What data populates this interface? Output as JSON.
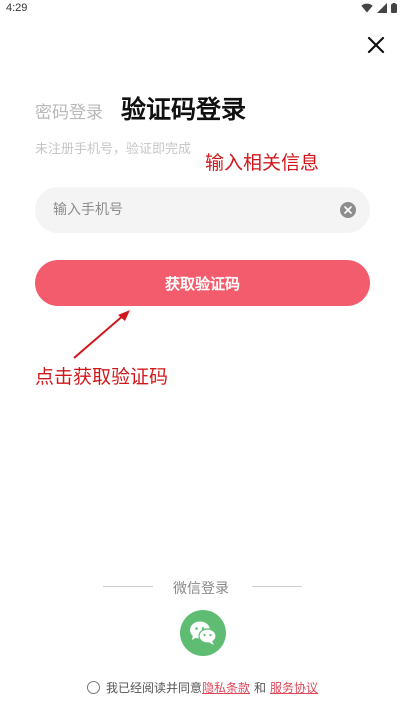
{
  "status_bar": {
    "time": "4:29"
  },
  "tabs": {
    "password_login": "密码登录",
    "code_login": "验证码登录"
  },
  "subtitle": "未注册手机号，验证即完成",
  "phone": {
    "placeholder": "输入手机号",
    "value": ""
  },
  "get_code_button": "获取验证码",
  "annotations": {
    "input_info": "输入相关信息",
    "click_get_code": "点击获取验证码"
  },
  "wechat_login_label": "微信登录",
  "agreement": {
    "prefix": "我已经阅读并同意",
    "privacy": "隐私条款",
    "and": "和",
    "service": "服务协议"
  },
  "colors": {
    "accent": "#f25c6c",
    "wechat": "#5ebd73",
    "annotation": "#d0181c",
    "link": "#e0485a"
  }
}
